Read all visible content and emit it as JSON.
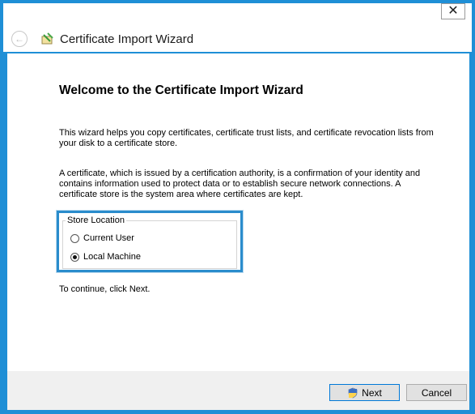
{
  "window": {
    "title": "Certificate Import Wizard",
    "close_glyph": "✕"
  },
  "header": {
    "back_icon": "back-arrow-icon",
    "wizard_icon": "certificate-wizard-icon"
  },
  "main": {
    "heading": "Welcome to the Certificate Import Wizard",
    "paragraph1": "This wizard helps you copy certificates, certificate trust lists, and certificate revocation lists from your disk to a certificate store.",
    "paragraph2": "A certificate, which is issued by a certification authority, is a confirmation of your identity and contains information used to protect data or to establish secure network connections. A certificate store is the system area where certificates are kept.",
    "store_location": {
      "legend": "Store Location",
      "options": [
        {
          "label": "Current User",
          "checked": false
        },
        {
          "label": "Local Machine",
          "checked": true
        }
      ]
    },
    "continue_text": "To continue, click Next."
  },
  "footer": {
    "next_label": "Next",
    "cancel_label": "Cancel"
  },
  "colors": {
    "highlight": "#2a8ccc",
    "window_border": "#1f8fd6"
  }
}
